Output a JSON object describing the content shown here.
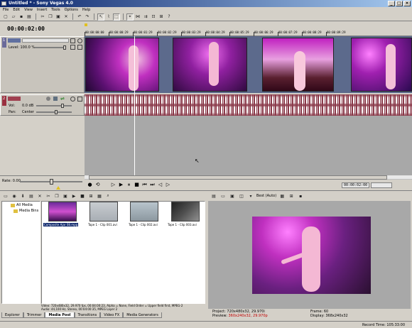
{
  "window": {
    "title": "Untitled * - Sony Vegas 4.0"
  },
  "menu": [
    "File",
    "Edit",
    "View",
    "Insert",
    "Tools",
    "Options",
    "Help"
  ],
  "timeline": {
    "cursor_time": "00:00:02:00",
    "ruler_ticks": [
      "00:00:00:00",
      "00:00:00:29",
      "00:00:01:29",
      "00:00:02:29",
      "00:00:03:29",
      "00:00:04:29",
      "00:00:05:29",
      "00:00:06:29",
      "00:00:07:29",
      "00:00:08:29",
      "00:00:09:29"
    ]
  },
  "video_track": {
    "number": "1",
    "level_label": "Level: 100.0 %"
  },
  "audio_track": {
    "number": "2",
    "vol_label": "Vol:",
    "vol_value": "0.0 dB",
    "pan_label": "Pan:",
    "pan_value": "Center"
  },
  "transport": {
    "rate_label": "Rate: 0.00",
    "time": "00:00:02:00"
  },
  "media_pool": {
    "tree": [
      "All Media",
      "Media Bins"
    ],
    "items": [
      {
        "label": "Composite Ajar 08.mpg"
      },
      {
        "label": "Tape 1 - Clip 001.avi"
      },
      {
        "label": "Tape 1 - Clip 002.avi"
      },
      {
        "label": "Tape 1 - Clip 003.avi"
      }
    ],
    "info_line1": "Video: 720x480x32, 29.970 fps, 00:04:00:23, Alpha = None, Field Order = Upper field first, MPEG-2",
    "info_line2": "Audio: 44,100 Hz, Stereo, 00:04:00:35, MPEG Layer 2"
  },
  "tabs": [
    {
      "label": "Explorer"
    },
    {
      "label": "Trimmer"
    },
    {
      "label": "Media Pool",
      "active": true
    },
    {
      "label": "Transitions"
    },
    {
      "label": "Video FX"
    },
    {
      "label": "Media Generators"
    }
  ],
  "preview": {
    "quality": "Best (Auto)",
    "project_label": "Project:",
    "project_value": "720x480x32, 29.970i",
    "preview_label": "Preview:",
    "preview_value": "360x240x32, 29.970p",
    "frame_label": "Frame:",
    "frame_value": "60",
    "display_label": "Display:",
    "display_value": "368x240x32"
  },
  "status": {
    "record_time": "Record Time: 105:33:00"
  }
}
